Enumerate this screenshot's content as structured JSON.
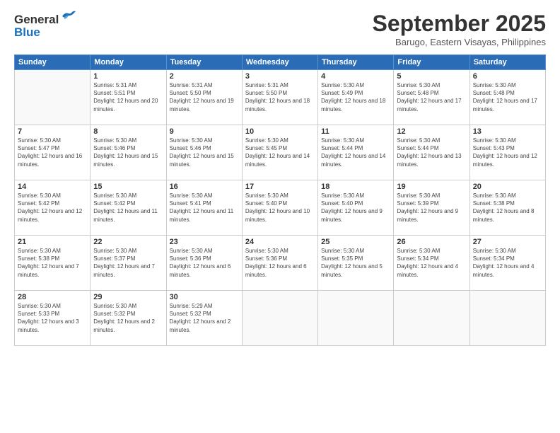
{
  "header": {
    "logo_general": "General",
    "logo_blue": "Blue",
    "month_title": "September 2025",
    "location": "Barugo, Eastern Visayas, Philippines"
  },
  "days_of_week": [
    "Sunday",
    "Monday",
    "Tuesday",
    "Wednesday",
    "Thursday",
    "Friday",
    "Saturday"
  ],
  "weeks": [
    [
      {
        "day": "",
        "sunrise": "",
        "sunset": "",
        "daylight": ""
      },
      {
        "day": "1",
        "sunrise": "Sunrise: 5:31 AM",
        "sunset": "Sunset: 5:51 PM",
        "daylight": "Daylight: 12 hours and 20 minutes."
      },
      {
        "day": "2",
        "sunrise": "Sunrise: 5:31 AM",
        "sunset": "Sunset: 5:50 PM",
        "daylight": "Daylight: 12 hours and 19 minutes."
      },
      {
        "day": "3",
        "sunrise": "Sunrise: 5:31 AM",
        "sunset": "Sunset: 5:50 PM",
        "daylight": "Daylight: 12 hours and 18 minutes."
      },
      {
        "day": "4",
        "sunrise": "Sunrise: 5:30 AM",
        "sunset": "Sunset: 5:49 PM",
        "daylight": "Daylight: 12 hours and 18 minutes."
      },
      {
        "day": "5",
        "sunrise": "Sunrise: 5:30 AM",
        "sunset": "Sunset: 5:48 PM",
        "daylight": "Daylight: 12 hours and 17 minutes."
      },
      {
        "day": "6",
        "sunrise": "Sunrise: 5:30 AM",
        "sunset": "Sunset: 5:48 PM",
        "daylight": "Daylight: 12 hours and 17 minutes."
      }
    ],
    [
      {
        "day": "7",
        "sunrise": "Sunrise: 5:30 AM",
        "sunset": "Sunset: 5:47 PM",
        "daylight": "Daylight: 12 hours and 16 minutes."
      },
      {
        "day": "8",
        "sunrise": "Sunrise: 5:30 AM",
        "sunset": "Sunset: 5:46 PM",
        "daylight": "Daylight: 12 hours and 15 minutes."
      },
      {
        "day": "9",
        "sunrise": "Sunrise: 5:30 AM",
        "sunset": "Sunset: 5:46 PM",
        "daylight": "Daylight: 12 hours and 15 minutes."
      },
      {
        "day": "10",
        "sunrise": "Sunrise: 5:30 AM",
        "sunset": "Sunset: 5:45 PM",
        "daylight": "Daylight: 12 hours and 14 minutes."
      },
      {
        "day": "11",
        "sunrise": "Sunrise: 5:30 AM",
        "sunset": "Sunset: 5:44 PM",
        "daylight": "Daylight: 12 hours and 14 minutes."
      },
      {
        "day": "12",
        "sunrise": "Sunrise: 5:30 AM",
        "sunset": "Sunset: 5:44 PM",
        "daylight": "Daylight: 12 hours and 13 minutes."
      },
      {
        "day": "13",
        "sunrise": "Sunrise: 5:30 AM",
        "sunset": "Sunset: 5:43 PM",
        "daylight": "Daylight: 12 hours and 12 minutes."
      }
    ],
    [
      {
        "day": "14",
        "sunrise": "Sunrise: 5:30 AM",
        "sunset": "Sunset: 5:42 PM",
        "daylight": "Daylight: 12 hours and 12 minutes."
      },
      {
        "day": "15",
        "sunrise": "Sunrise: 5:30 AM",
        "sunset": "Sunset: 5:42 PM",
        "daylight": "Daylight: 12 hours and 11 minutes."
      },
      {
        "day": "16",
        "sunrise": "Sunrise: 5:30 AM",
        "sunset": "Sunset: 5:41 PM",
        "daylight": "Daylight: 12 hours and 11 minutes."
      },
      {
        "day": "17",
        "sunrise": "Sunrise: 5:30 AM",
        "sunset": "Sunset: 5:40 PM",
        "daylight": "Daylight: 12 hours and 10 minutes."
      },
      {
        "day": "18",
        "sunrise": "Sunrise: 5:30 AM",
        "sunset": "Sunset: 5:40 PM",
        "daylight": "Daylight: 12 hours and 9 minutes."
      },
      {
        "day": "19",
        "sunrise": "Sunrise: 5:30 AM",
        "sunset": "Sunset: 5:39 PM",
        "daylight": "Daylight: 12 hours and 9 minutes."
      },
      {
        "day": "20",
        "sunrise": "Sunrise: 5:30 AM",
        "sunset": "Sunset: 5:38 PM",
        "daylight": "Daylight: 12 hours and 8 minutes."
      }
    ],
    [
      {
        "day": "21",
        "sunrise": "Sunrise: 5:30 AM",
        "sunset": "Sunset: 5:38 PM",
        "daylight": "Daylight: 12 hours and 7 minutes."
      },
      {
        "day": "22",
        "sunrise": "Sunrise: 5:30 AM",
        "sunset": "Sunset: 5:37 PM",
        "daylight": "Daylight: 12 hours and 7 minutes."
      },
      {
        "day": "23",
        "sunrise": "Sunrise: 5:30 AM",
        "sunset": "Sunset: 5:36 PM",
        "daylight": "Daylight: 12 hours and 6 minutes."
      },
      {
        "day": "24",
        "sunrise": "Sunrise: 5:30 AM",
        "sunset": "Sunset: 5:36 PM",
        "daylight": "Daylight: 12 hours and 6 minutes."
      },
      {
        "day": "25",
        "sunrise": "Sunrise: 5:30 AM",
        "sunset": "Sunset: 5:35 PM",
        "daylight": "Daylight: 12 hours and 5 minutes."
      },
      {
        "day": "26",
        "sunrise": "Sunrise: 5:30 AM",
        "sunset": "Sunset: 5:34 PM",
        "daylight": "Daylight: 12 hours and 4 minutes."
      },
      {
        "day": "27",
        "sunrise": "Sunrise: 5:30 AM",
        "sunset": "Sunset: 5:34 PM",
        "daylight": "Daylight: 12 hours and 4 minutes."
      }
    ],
    [
      {
        "day": "28",
        "sunrise": "Sunrise: 5:30 AM",
        "sunset": "Sunset: 5:33 PM",
        "daylight": "Daylight: 12 hours and 3 minutes."
      },
      {
        "day": "29",
        "sunrise": "Sunrise: 5:30 AM",
        "sunset": "Sunset: 5:32 PM",
        "daylight": "Daylight: 12 hours and 2 minutes."
      },
      {
        "day": "30",
        "sunrise": "Sunrise: 5:29 AM",
        "sunset": "Sunset: 5:32 PM",
        "daylight": "Daylight: 12 hours and 2 minutes."
      },
      {
        "day": "",
        "sunrise": "",
        "sunset": "",
        "daylight": ""
      },
      {
        "day": "",
        "sunrise": "",
        "sunset": "",
        "daylight": ""
      },
      {
        "day": "",
        "sunrise": "",
        "sunset": "",
        "daylight": ""
      },
      {
        "day": "",
        "sunrise": "",
        "sunset": "",
        "daylight": ""
      }
    ]
  ]
}
